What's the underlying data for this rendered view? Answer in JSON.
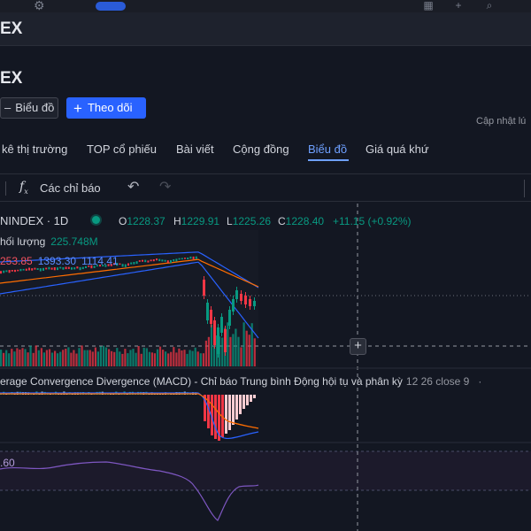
{
  "header": {
    "window_title": "EX"
  },
  "page": {
    "title": "EX"
  },
  "actions": {
    "chart_button": "Biểu đồ",
    "follow_button": "Theo dõi"
  },
  "updated_label": "Cập nhật lú",
  "tabs": [
    {
      "label": "kê thị trường"
    },
    {
      "label": "TOP cổ phiếu"
    },
    {
      "label": "Bài viết"
    },
    {
      "label": "Cộng đồng"
    },
    {
      "label": "Biểu đồ",
      "active": true
    },
    {
      "label": "Giá quá khứ"
    }
  ],
  "toolbar": {
    "indicators_label": "Các chỉ báo"
  },
  "legend": {
    "symbol": "NINDEX · 1D",
    "o_label": "O",
    "o": "1228.37",
    "h_label": "H",
    "h": "1229.91",
    "l_label": "L",
    "l": "1225.26",
    "c_label": "C",
    "c": "1228.40",
    "change": "+11.15 (+0.92%)",
    "volume_label": "hối lượng",
    "volume_value": "225.748M",
    "bb_basis": "253.85",
    "bb_upper": "1393.30",
    "bb_lower": "1114.41"
  },
  "macd": {
    "title": "erage Convergence Divergence (MACD) - Chỉ báo Trung bình Động hội tụ và phân kỳ",
    "params": "12 26 close 9",
    "more": "·"
  },
  "rsi": {
    "level_label": ".60"
  },
  "colors": {
    "up": "#089981",
    "down": "#f23645",
    "accent": "#2962ff",
    "band_upper": "#2962ff",
    "band_basis": "#ff6d00",
    "rsi": "#7e57c2"
  },
  "chart_data": {
    "type": "candlestick",
    "volume_bars": 95,
    "rsi_value_shown": ".60"
  }
}
